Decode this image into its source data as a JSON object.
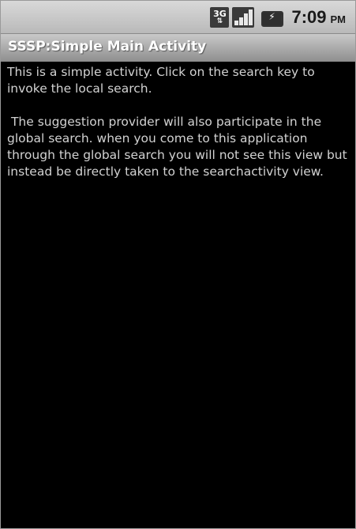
{
  "status_bar": {
    "network_type": "3G",
    "network_arrows": "⇅",
    "time": "7:09",
    "ampm": "PM"
  },
  "title_bar": {
    "title": "SSSP:Simple Main Activity"
  },
  "content": {
    "paragraph_1": "This is a simple activity. Click on the search key to invoke the local search.",
    "paragraph_2": " The suggestion provider will also participate in the global search. when you come to this application through the global search you will not see this view but instead be directly taken to the searchactivity view."
  },
  "colors": {
    "background": "#000000",
    "body_text": "#d2d2d2",
    "title_text": "#ffffff"
  }
}
